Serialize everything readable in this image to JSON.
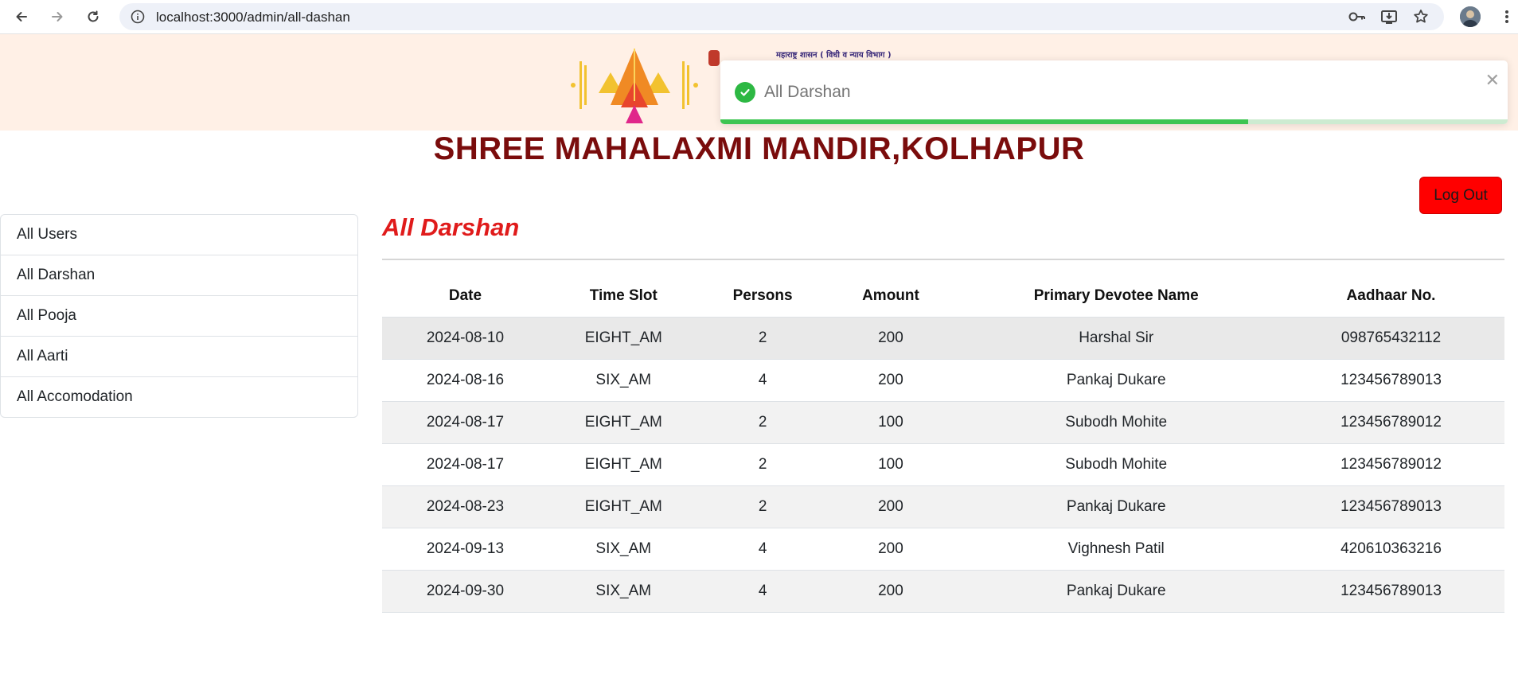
{
  "browser": {
    "url": "localhost:3000/admin/all-dashan",
    "icons": [
      "back-icon",
      "forward-icon",
      "reload-icon",
      "site-info-icon",
      "password-key-icon",
      "install-app-icon",
      "bookmark-star-icon",
      "profile-avatar",
      "more-menu-icon"
    ]
  },
  "banner": {
    "gov_text": "महाराष्ट्र शासन ( विधी व न्याय विभाग )"
  },
  "site": {
    "title": "SHREE MAHALAXMI MANDIR,KOLHAPUR",
    "logout_label": "Log Out",
    "logout_color": "#ff0000",
    "title_color": "#7a0c0c"
  },
  "sidebar": {
    "items": [
      {
        "label": "All Users"
      },
      {
        "label": "All Darshan"
      },
      {
        "label": "All Pooja"
      },
      {
        "label": "All Aarti"
      },
      {
        "label": "All Accomodation"
      }
    ]
  },
  "main": {
    "heading": "All Darshan",
    "heading_color": "#e01b1b",
    "table": {
      "columns": [
        "Date",
        "Time Slot",
        "Persons",
        "Amount",
        "Primary Devotee Name",
        "Aadhaar No."
      ],
      "rows": [
        [
          "2024-08-10",
          "EIGHT_AM",
          "2",
          "200",
          "Harshal Sir",
          "098765432112"
        ],
        [
          "2024-08-16",
          "SIX_AM",
          "4",
          "200",
          "Pankaj Dukare",
          "123456789013"
        ],
        [
          "2024-08-17",
          "EIGHT_AM",
          "2",
          "100",
          "Subodh Mohite",
          "123456789012"
        ],
        [
          "2024-08-17",
          "EIGHT_AM",
          "2",
          "100",
          "Subodh Mohite",
          "123456789012"
        ],
        [
          "2024-08-23",
          "EIGHT_AM",
          "2",
          "200",
          "Pankaj Dukare",
          "123456789013"
        ],
        [
          "2024-09-13",
          "SIX_AM",
          "4",
          "200",
          "Vighnesh Patil",
          "420610363216"
        ],
        [
          "2024-09-30",
          "SIX_AM",
          "4",
          "200",
          "Pankaj Dukare",
          "123456789013"
        ]
      ]
    }
  },
  "toast": {
    "message": "All Darshan",
    "type": "success",
    "icon": "check-circle-icon",
    "progress": 0.67,
    "accent": "#3ec552"
  }
}
